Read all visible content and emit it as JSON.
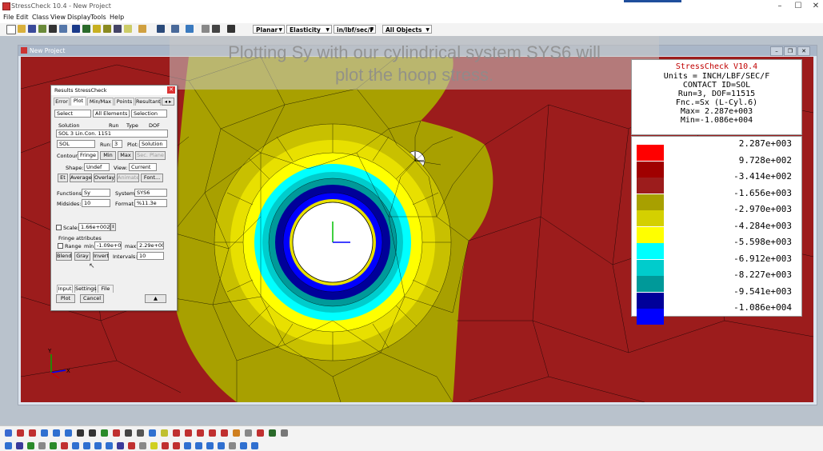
{
  "app": {
    "title": "StressCheck 10.4 - New Project"
  },
  "menu": [
    "File",
    "Edit",
    "Class",
    "View",
    "Display",
    "Tools",
    "Help"
  ],
  "toolbar": {
    "combos": [
      "Planar",
      "Elasticity",
      "in/lbf/sec/F",
      "All Objects"
    ]
  },
  "document": {
    "title": "New Project"
  },
  "overlay": {
    "line1": "Plotting Sy with our cylindrical system SYS6 will",
    "line2": "plot the hoop stress."
  },
  "info": {
    "lines": [
      "StressCheck V10.4",
      "Units = INCH/LBF/SEC/F",
      "CONTACT ID=SOL",
      "Run=3, DOF=11515",
      "Fnc.=Sx (L-Cyl.6)",
      "Max= 2.287e+003",
      "Min=-1.086e+004"
    ],
    "title_color": "#c00000"
  },
  "legend": [
    {
      "value": "2.287e+003",
      "color": "#ff0000"
    },
    {
      "value": "9.728e+002",
      "color": "#a00000"
    },
    {
      "value": "-3.414e+002",
      "color": "#9c1c1c"
    },
    {
      "value": "-1.656e+003",
      "color": "#a8a000"
    },
    {
      "value": "-2.970e+003",
      "color": "#d4d000"
    },
    {
      "value": "-4.284e+003",
      "color": "#ffff00"
    },
    {
      "value": "-5.598e+003",
      "color": "#00ffff"
    },
    {
      "value": "-6.912e+003",
      "color": "#00cccc"
    },
    {
      "value": "-8.227e+003",
      "color": "#009999"
    },
    {
      "value": "-9.541e+003",
      "color": "#000099"
    },
    {
      "value": "-1.086e+004",
      "color": "#0000ff"
    }
  ],
  "dialog": {
    "title": "Results StressCheck",
    "tabs": [
      "Error",
      "Plot",
      "Min/Max",
      "Points",
      "Resultant"
    ],
    "tab_arrows": "◂ ▸",
    "select_combos": [
      "Select",
      "All Elements",
      "Selection"
    ],
    "table_headers": {
      "solution": "Solution",
      "run": "Run",
      "type": "Type",
      "dof": "DOF"
    },
    "table_row": "SOL            3  Lin.Con. 1151",
    "solution_value": "SOL",
    "run_label": "Run:",
    "run_value": "3",
    "plot_label": "Plot:",
    "plot_value": "Solution",
    "contour_label": "Contour:",
    "contour_buttons": [
      "Fringe",
      "Min",
      "Max",
      "Sec. Plane"
    ],
    "shape_label": "Shape:",
    "shape_value": "Undef",
    "view_label": "View:",
    "view_value": "Current",
    "action_buttons": [
      "Et",
      "Average",
      "Overlay",
      "Animate",
      "Font..."
    ],
    "functions_label": "Functions:",
    "functions_value": "Sy",
    "system_label": "System:",
    "system_value": "SYS6",
    "midsides_label": "Midsides:",
    "midsides_value": "10",
    "format_label": "Format:",
    "format_value": "%11.3e",
    "scale_label": "Scale:",
    "scale_value": "1.66e+002",
    "fringe_attr_label": "Fringe attributes",
    "range_label": "Range",
    "min_label": "min:",
    "min_value": "-1.09e+004",
    "max_label": "max:",
    "max_value": "2.29e+003",
    "blend": "Blend",
    "gray": "Gray",
    "invert": "Invert",
    "intervals_label": "Intervals:",
    "intervals_value": "10",
    "bottom_tabs": [
      "Input",
      "Settings",
      "File"
    ],
    "plot_button": "Plot",
    "cancel_button": "Cancel",
    "collapse_button": "▲"
  },
  "axes": {
    "y": "Y",
    "x": "X"
  }
}
